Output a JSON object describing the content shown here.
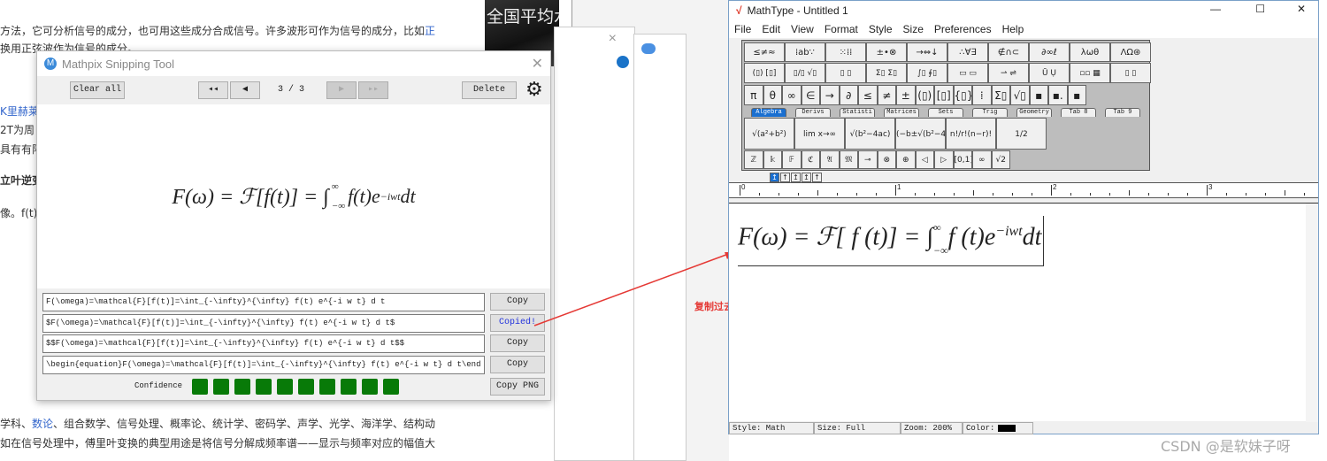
{
  "article": {
    "line1": "方法，它可分析信号的成分，也可用这些成分合成信号。许多波形可作为信号的成分，比如",
    "line1_link": "正",
    "line2": "换用正弦波作为信号的成分。",
    "side_link": "K里赫莱",
    "side2": "2T为周",
    "side3": "具有有限",
    "side4": "立叶逆变",
    "side5": "像。f(t)",
    "bottom1_pre": "学科、",
    "bottom1_link": "数论",
    "bottom1_post": "、组合数学、信号处理、概率论、统计学、密码学、声学、光学、海洋学、结构动",
    "bottom2": "如在信号处理中，傅里叶变换的典型用途是将信号分解成频率谱——显示与频率对应的幅值大",
    "news_text": "全国平均水"
  },
  "mathpix": {
    "title": "Mathpix Snipping Tool",
    "clear_all": "Clear all",
    "first": "◂◂",
    "prev": "◀",
    "next": "▶",
    "last": "▸▸",
    "page": "3 / 3",
    "delete": "Delete",
    "formula": "F(ω) = ℱ[f(t)] = ∫₋∞^∞ f(t)e^{−iwt}dt",
    "formula_main": "F(ω) = ℱ[f(t)] = ∫",
    "formula_rest": "f(t)e",
    "formula_sup": "−iwt",
    "formula_dt": "dt",
    "rows": [
      {
        "value": "F(\\omega)=\\mathcal{F}[f(t)]=\\int_{-\\infty}^{\\infty} f(t) e^{-i w t} d t",
        "button": "Copy"
      },
      {
        "value": "$F(\\omega)=\\mathcal{F}[f(t)]=\\int_{-\\infty}^{\\infty} f(t) e^{-i w t} d t$",
        "button": "Copied!"
      },
      {
        "value": "$$F(\\omega)=\\mathcal{F}[f(t)]=\\int_{-\\infty}^{\\infty} f(t) e^{-i w t} d t$$",
        "button": "Copy"
      },
      {
        "value": "\\begin{equation}F(\\omega)=\\mathcal{F}[f(t)]=\\int_{-\\infty}^{\\infty} f(t) e^{-i w t} d t\\end",
        "button": "Copy"
      }
    ],
    "confidence_label": "Confidence",
    "confidence_level": 10,
    "confidence_max": 10,
    "copy_png": "Copy PNG",
    "confidence_color": "#087a08"
  },
  "annotation": {
    "text": "复制过去",
    "color": "#e53935"
  },
  "mathtype": {
    "title": "MathType - Untitled 1",
    "menu": [
      "File",
      "Edit",
      "View",
      "Format",
      "Style",
      "Size",
      "Preferences",
      "Help"
    ],
    "row1": [
      "≤≠≈",
      "⁞ab∵",
      "⁙⁞⁞",
      "±•⊗",
      "→⇔↓",
      "∴∀∃",
      "∉∩⊂",
      "∂∞ℓ",
      "λωθ",
      "ΛΩ⊛"
    ],
    "row2": [
      "(▯) [▯]",
      "▯/▯ √▯",
      "▯ ▯",
      "Σ▯ Σ▯",
      "∫▯ ∮▯",
      "▭ ▭",
      "⇀ ⇌",
      "Ū Ụ",
      "▫▫ ▦",
      "▯ ▯"
    ],
    "row3": [
      "π",
      "θ",
      "∞",
      "∈",
      "→",
      "∂",
      "≤",
      "≠",
      "±",
      "(▯)",
      "[▯]",
      "{▯}",
      "⁞",
      "Σ▯",
      "√▯",
      "▪",
      "▪.",
      "▪"
    ],
    "tabs": [
      "Algebra",
      "Derivs",
      "Statisti",
      "Matrices",
      "Sets",
      "Trig",
      "Geometry",
      "Tab 8",
      "Tab 9"
    ],
    "row4": [
      "√(a²+b²)",
      "lim x→∞",
      "√(b²−4ac)",
      "(−b±√(b²−4ac))/2a",
      "n!/r!(n−r)!",
      "1/2"
    ],
    "row5": [
      "ℤ",
      "𝕜",
      "𝔽",
      "ℭ",
      "𝔄",
      "𝔐",
      "⊸",
      "⊗",
      "⊕",
      "◁",
      "▷",
      "[0,1]",
      "∞",
      "√2"
    ],
    "nudge": [
      "↥",
      "↑",
      "↥",
      "↥",
      "↑"
    ],
    "ruler_labels": [
      "0",
      "1",
      "2",
      "3"
    ],
    "equation_main": "F(ω) = ℱ[ f (t)] = ∫",
    "equation_rest": "f (t)e",
    "equation_sup": "−iwt",
    "equation_dt": "dt",
    "int_upper": "∞",
    "int_lower": "−∞",
    "status": {
      "style": "Style: Math",
      "size": "Size: Full",
      "zoom": "Zoom: 200%",
      "color_label": "Color:",
      "color": "#000000"
    }
  },
  "watermark": "CSDN @是软妹子呀"
}
